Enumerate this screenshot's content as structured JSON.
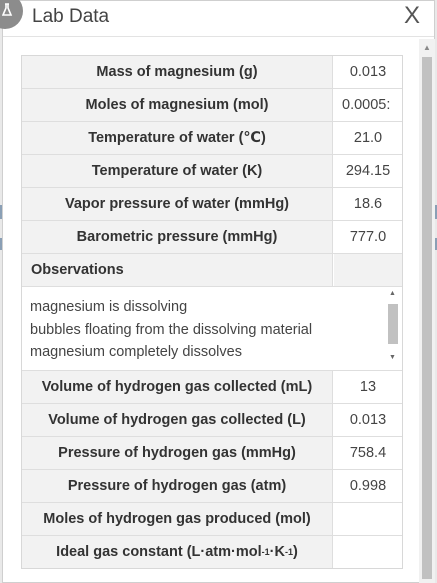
{
  "window": {
    "title": "Lab Data",
    "close_label": "X"
  },
  "table": {
    "rows_top": [
      {
        "label": "Mass of magnesium (g)",
        "value": "0.013"
      },
      {
        "label": "Moles of magnesium (mol)",
        "value": "0.0005:"
      },
      {
        "label": "Temperature of water (℃)",
        "value": "21.0"
      },
      {
        "label": "Temperature of water (K)",
        "value": "294.15"
      },
      {
        "label": "Vapor pressure of water (mmHg)",
        "value": "18.6"
      },
      {
        "label": "Barometric pressure (mmHg)",
        "value": "777.0"
      }
    ],
    "observations_label": "Observations",
    "observations": [
      "magnesium is dissolving",
      "bubbles floating from the dissolving material",
      "magnesium completely dissolves"
    ],
    "rows_bottom": [
      {
        "label": "Volume of hydrogen gas collected (mL)",
        "value": "13"
      },
      {
        "label": "Volume of hydrogen gas collected (L)",
        "value": "0.013"
      },
      {
        "label": "Pressure of hydrogen gas (mmHg)",
        "value": "758.4"
      },
      {
        "label": "Pressure of hydrogen gas (atm)",
        "value": "0.998"
      },
      {
        "label": "Moles of hydrogen gas produced (mol)",
        "value": ""
      }
    ],
    "ideal_gas": {
      "label_main": "Ideal gas constant (L·atm·mol",
      "exp1": "-1",
      "label_mid": "·K",
      "exp2": "-1",
      "label_end": ")",
      "value": ""
    }
  }
}
